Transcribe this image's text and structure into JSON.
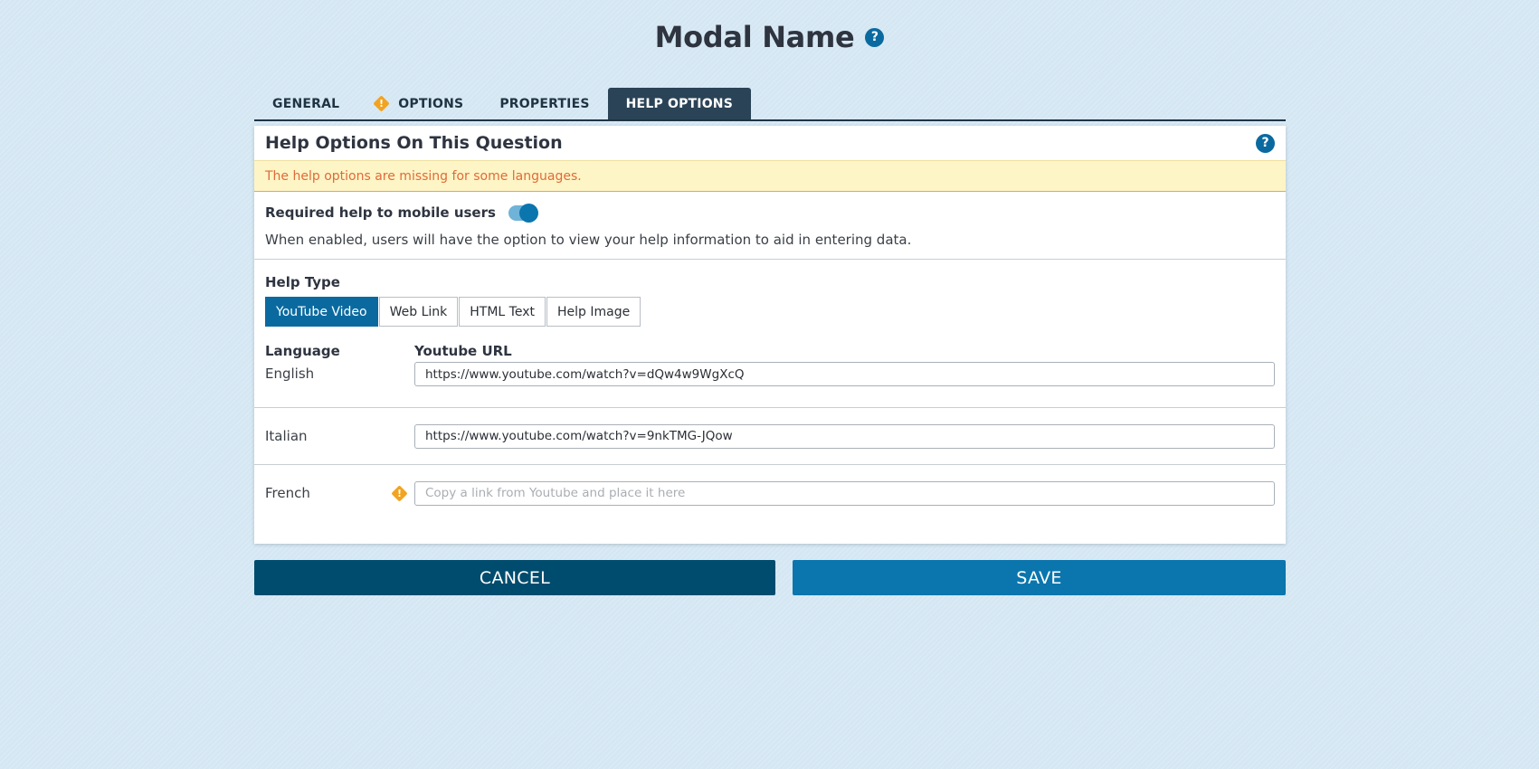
{
  "modal": {
    "title": "Modal Name"
  },
  "tabs": [
    {
      "label": "GENERAL"
    },
    {
      "label": "OPTIONS",
      "warning": true
    },
    {
      "label": "PROPERTIES"
    },
    {
      "label": "HELP OPTIONS",
      "active": true
    }
  ],
  "card": {
    "title": "Help Options On This Question",
    "alert": "The help options are missing for some languages.",
    "required_label": "Required help to mobile users",
    "required_enabled": true,
    "description": "When enabled, users will have the option to view your help information to aid in entering data.",
    "help_type_label": "Help Type",
    "help_types": [
      "YouTube Video",
      "Web Link",
      "HTML Text",
      "Help Image"
    ],
    "selected_help_type": "YouTube Video",
    "language_col": "Language",
    "url_col": "Youtube URL",
    "languages": [
      {
        "name": "English",
        "value": "https://www.youtube.com/watch?v=dQw4w9WgXcQ"
      },
      {
        "name": "Italian",
        "value": "https://www.youtube.com/watch?v=9nkTMG-JQow"
      },
      {
        "name": "French",
        "value": "",
        "placeholder": "Copy a link from Youtube and place it here",
        "warning": true
      }
    ]
  },
  "buttons": {
    "cancel": "CANCEL",
    "save": "SAVE"
  },
  "colors": {
    "accent": "#0a6aa0",
    "dark": "#004c6e",
    "warning": "#f2a31f",
    "alert_bg": "#fdf5c5",
    "alert_text": "#e06a3b"
  },
  "icons": {
    "help": "question-circle-icon",
    "warning": "warning-diamond-icon"
  }
}
